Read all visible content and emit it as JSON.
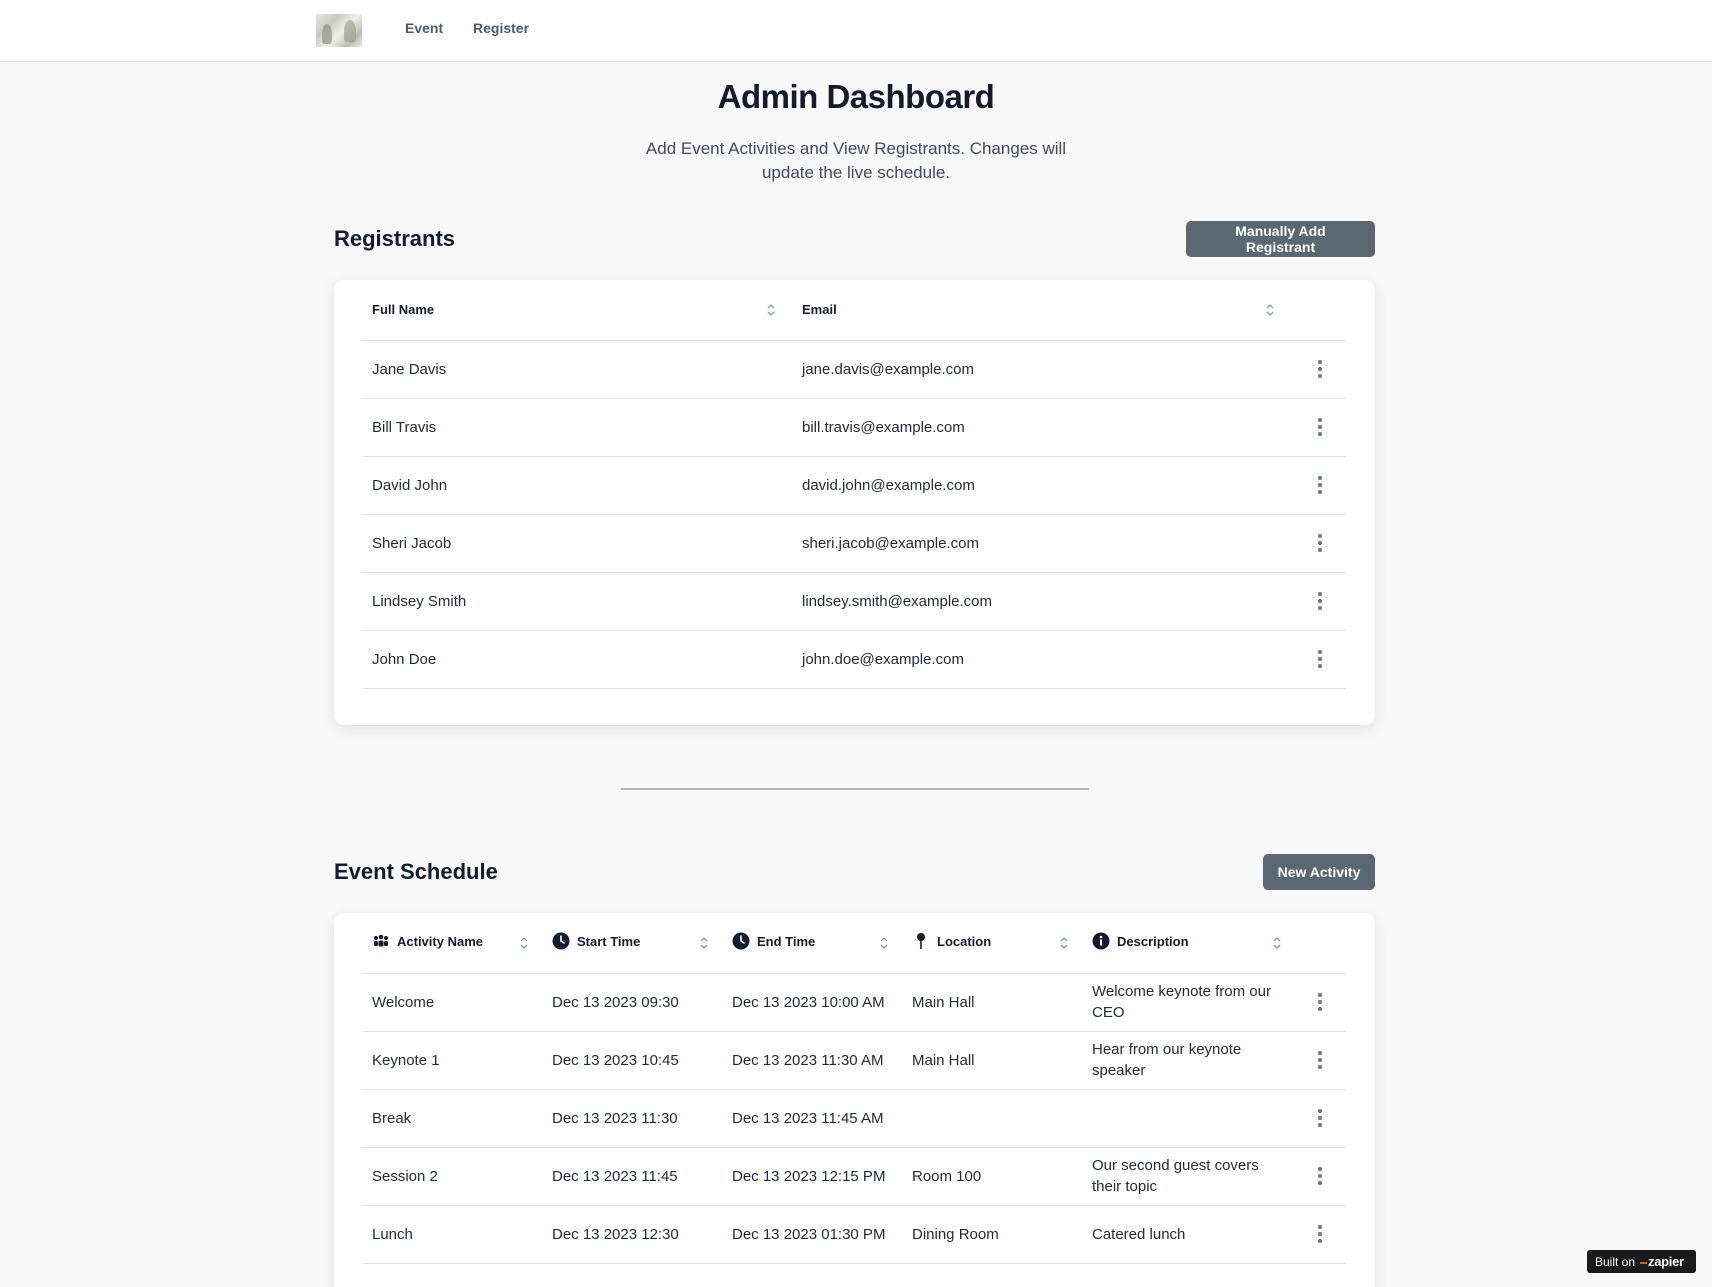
{
  "nav": {
    "logo_alt": "Event logo",
    "links": [
      "Event",
      "Register"
    ]
  },
  "header": {
    "title": "Admin Dashboard",
    "subtitle": "Add Event Activities and View Registrants. Changes will update the live schedule."
  },
  "registrants": {
    "title": "Registrants",
    "add_button": "Manually Add Registrant",
    "columns": [
      "Full Name",
      "Email"
    ],
    "rows": [
      {
        "name": "Jane Davis",
        "email": "jane.davis@example.com"
      },
      {
        "name": "Bill Travis",
        "email": "bill.travis@example.com"
      },
      {
        "name": "David John",
        "email": "david.john@example.com"
      },
      {
        "name": "Sheri Jacob",
        "email": "sheri.jacob@example.com"
      },
      {
        "name": "Lindsey Smith",
        "email": "lindsey.smith@example.com"
      },
      {
        "name": "John Doe",
        "email": "john.doe@example.com"
      }
    ]
  },
  "schedule": {
    "title": "Event Schedule",
    "add_button": "New Activity",
    "columns": [
      {
        "label": "Activity Name",
        "icon": "people-icon"
      },
      {
        "label": "Start Time",
        "icon": "clock-icon"
      },
      {
        "label": "End Time",
        "icon": "clock-icon"
      },
      {
        "label": "Location",
        "icon": "pin-icon"
      },
      {
        "label": "Description",
        "icon": "info-icon"
      }
    ],
    "rows": [
      {
        "activity": "Welcome",
        "start": "Dec 13 2023 09:30",
        "end": "Dec 13 2023 10:00 AM",
        "location": "Main Hall",
        "description": "Welcome keynote from our CEO"
      },
      {
        "activity": "Keynote 1",
        "start": "Dec 13 2023 10:45",
        "end": "Dec 13 2023 11:30 AM",
        "location": "Main Hall",
        "description": "Hear from our keynote speaker"
      },
      {
        "activity": "Break",
        "start": "Dec 13 2023 11:30",
        "end": "Dec 13 2023 11:45 AM",
        "location": "",
        "description": ""
      },
      {
        "activity": "Session 2",
        "start": "Dec 13 2023 11:45",
        "end": "Dec 13 2023 12:15 PM",
        "location": "Room 100",
        "description": "Our second guest covers their topic"
      },
      {
        "activity": "Lunch",
        "start": "Dec 13 2023 12:30",
        "end": "Dec 13 2023 01:30 PM",
        "location": "Dining Room",
        "description": "Catered lunch"
      }
    ]
  },
  "badge": {
    "prefix": "Built on",
    "brand": "zapier"
  },
  "colors": {
    "button_bg": "#5a6872",
    "heading": "#131c2e",
    "nav_link": "#4b5a70",
    "divider": "#aab6c2"
  }
}
